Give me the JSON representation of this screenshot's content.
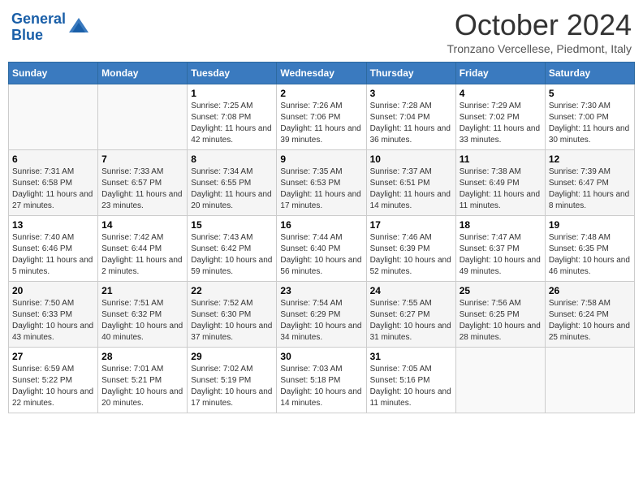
{
  "header": {
    "logo_line1": "General",
    "logo_line2": "Blue",
    "month_title": "October 2024",
    "subtitle": "Tronzano Vercellese, Piedmont, Italy"
  },
  "days_of_week": [
    "Sunday",
    "Monday",
    "Tuesday",
    "Wednesday",
    "Thursday",
    "Friday",
    "Saturday"
  ],
  "weeks": [
    [
      {
        "day": "",
        "sunrise": "",
        "sunset": "",
        "daylight": ""
      },
      {
        "day": "",
        "sunrise": "",
        "sunset": "",
        "daylight": ""
      },
      {
        "day": "1",
        "sunrise": "Sunrise: 7:25 AM",
        "sunset": "Sunset: 7:08 PM",
        "daylight": "Daylight: 11 hours and 42 minutes."
      },
      {
        "day": "2",
        "sunrise": "Sunrise: 7:26 AM",
        "sunset": "Sunset: 7:06 PM",
        "daylight": "Daylight: 11 hours and 39 minutes."
      },
      {
        "day": "3",
        "sunrise": "Sunrise: 7:28 AM",
        "sunset": "Sunset: 7:04 PM",
        "daylight": "Daylight: 11 hours and 36 minutes."
      },
      {
        "day": "4",
        "sunrise": "Sunrise: 7:29 AM",
        "sunset": "Sunset: 7:02 PM",
        "daylight": "Daylight: 11 hours and 33 minutes."
      },
      {
        "day": "5",
        "sunrise": "Sunrise: 7:30 AM",
        "sunset": "Sunset: 7:00 PM",
        "daylight": "Daylight: 11 hours and 30 minutes."
      }
    ],
    [
      {
        "day": "6",
        "sunrise": "Sunrise: 7:31 AM",
        "sunset": "Sunset: 6:58 PM",
        "daylight": "Daylight: 11 hours and 27 minutes."
      },
      {
        "day": "7",
        "sunrise": "Sunrise: 7:33 AM",
        "sunset": "Sunset: 6:57 PM",
        "daylight": "Daylight: 11 hours and 23 minutes."
      },
      {
        "day": "8",
        "sunrise": "Sunrise: 7:34 AM",
        "sunset": "Sunset: 6:55 PM",
        "daylight": "Daylight: 11 hours and 20 minutes."
      },
      {
        "day": "9",
        "sunrise": "Sunrise: 7:35 AM",
        "sunset": "Sunset: 6:53 PM",
        "daylight": "Daylight: 11 hours and 17 minutes."
      },
      {
        "day": "10",
        "sunrise": "Sunrise: 7:37 AM",
        "sunset": "Sunset: 6:51 PM",
        "daylight": "Daylight: 11 hours and 14 minutes."
      },
      {
        "day": "11",
        "sunrise": "Sunrise: 7:38 AM",
        "sunset": "Sunset: 6:49 PM",
        "daylight": "Daylight: 11 hours and 11 minutes."
      },
      {
        "day": "12",
        "sunrise": "Sunrise: 7:39 AM",
        "sunset": "Sunset: 6:47 PM",
        "daylight": "Daylight: 11 hours and 8 minutes."
      }
    ],
    [
      {
        "day": "13",
        "sunrise": "Sunrise: 7:40 AM",
        "sunset": "Sunset: 6:46 PM",
        "daylight": "Daylight: 11 hours and 5 minutes."
      },
      {
        "day": "14",
        "sunrise": "Sunrise: 7:42 AM",
        "sunset": "Sunset: 6:44 PM",
        "daylight": "Daylight: 11 hours and 2 minutes."
      },
      {
        "day": "15",
        "sunrise": "Sunrise: 7:43 AM",
        "sunset": "Sunset: 6:42 PM",
        "daylight": "Daylight: 10 hours and 59 minutes."
      },
      {
        "day": "16",
        "sunrise": "Sunrise: 7:44 AM",
        "sunset": "Sunset: 6:40 PM",
        "daylight": "Daylight: 10 hours and 56 minutes."
      },
      {
        "day": "17",
        "sunrise": "Sunrise: 7:46 AM",
        "sunset": "Sunset: 6:39 PM",
        "daylight": "Daylight: 10 hours and 52 minutes."
      },
      {
        "day": "18",
        "sunrise": "Sunrise: 7:47 AM",
        "sunset": "Sunset: 6:37 PM",
        "daylight": "Daylight: 10 hours and 49 minutes."
      },
      {
        "day": "19",
        "sunrise": "Sunrise: 7:48 AM",
        "sunset": "Sunset: 6:35 PM",
        "daylight": "Daylight: 10 hours and 46 minutes."
      }
    ],
    [
      {
        "day": "20",
        "sunrise": "Sunrise: 7:50 AM",
        "sunset": "Sunset: 6:33 PM",
        "daylight": "Daylight: 10 hours and 43 minutes."
      },
      {
        "day": "21",
        "sunrise": "Sunrise: 7:51 AM",
        "sunset": "Sunset: 6:32 PM",
        "daylight": "Daylight: 10 hours and 40 minutes."
      },
      {
        "day": "22",
        "sunrise": "Sunrise: 7:52 AM",
        "sunset": "Sunset: 6:30 PM",
        "daylight": "Daylight: 10 hours and 37 minutes."
      },
      {
        "day": "23",
        "sunrise": "Sunrise: 7:54 AM",
        "sunset": "Sunset: 6:29 PM",
        "daylight": "Daylight: 10 hours and 34 minutes."
      },
      {
        "day": "24",
        "sunrise": "Sunrise: 7:55 AM",
        "sunset": "Sunset: 6:27 PM",
        "daylight": "Daylight: 10 hours and 31 minutes."
      },
      {
        "day": "25",
        "sunrise": "Sunrise: 7:56 AM",
        "sunset": "Sunset: 6:25 PM",
        "daylight": "Daylight: 10 hours and 28 minutes."
      },
      {
        "day": "26",
        "sunrise": "Sunrise: 7:58 AM",
        "sunset": "Sunset: 6:24 PM",
        "daylight": "Daylight: 10 hours and 25 minutes."
      }
    ],
    [
      {
        "day": "27",
        "sunrise": "Sunrise: 6:59 AM",
        "sunset": "Sunset: 5:22 PM",
        "daylight": "Daylight: 10 hours and 22 minutes."
      },
      {
        "day": "28",
        "sunrise": "Sunrise: 7:01 AM",
        "sunset": "Sunset: 5:21 PM",
        "daylight": "Daylight: 10 hours and 20 minutes."
      },
      {
        "day": "29",
        "sunrise": "Sunrise: 7:02 AM",
        "sunset": "Sunset: 5:19 PM",
        "daylight": "Daylight: 10 hours and 17 minutes."
      },
      {
        "day": "30",
        "sunrise": "Sunrise: 7:03 AM",
        "sunset": "Sunset: 5:18 PM",
        "daylight": "Daylight: 10 hours and 14 minutes."
      },
      {
        "day": "31",
        "sunrise": "Sunrise: 7:05 AM",
        "sunset": "Sunset: 5:16 PM",
        "daylight": "Daylight: 10 hours and 11 minutes."
      },
      {
        "day": "",
        "sunrise": "",
        "sunset": "",
        "daylight": ""
      },
      {
        "day": "",
        "sunrise": "",
        "sunset": "",
        "daylight": ""
      }
    ]
  ]
}
